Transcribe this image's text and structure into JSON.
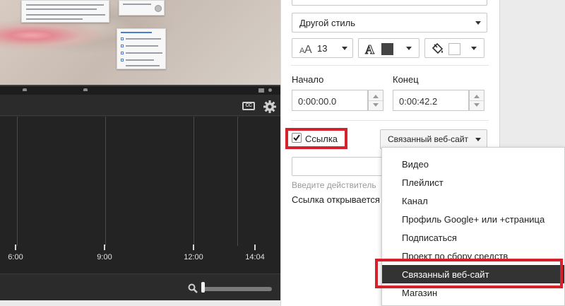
{
  "video": {
    "notes": [
      "annotation-card-1",
      "annotation-card-2",
      "annotation-card-3"
    ]
  },
  "timeline": {
    "cc_label": "CC",
    "ticks": [
      {
        "label": "6:00"
      },
      {
        "label": "9:00"
      },
      {
        "label": "12:00"
      },
      {
        "label": "14:04"
      }
    ],
    "zoom_level": 0.02
  },
  "editor": {
    "style_select": "Другой стиль",
    "font_size": "13",
    "text_color_icon": "font-color-icon",
    "fill_icon": "fill-bucket-icon",
    "colors": {
      "text_swatch": "#444444",
      "fill_swatch": "#ffffff",
      "highlight": "#d4212b"
    },
    "start_label": "Начало",
    "end_label": "Конец",
    "start_value": "0:00:00.0",
    "end_value": "0:00:42.2",
    "link_checkbox_label": "Ссылка",
    "link_checked": true,
    "link_type_select": "Связанный веб-сайт",
    "url_placeholder": "Введите действитель",
    "opens_text": "Ссылка открывается"
  },
  "link_menu": {
    "items": [
      "Видео",
      "Плейлист",
      "Канал",
      "Профиль Google+ или +страница",
      "Подписаться",
      "Проект по сбору средств",
      "Связанный веб-сайт",
      "Магазин"
    ],
    "selected_index": 6
  }
}
